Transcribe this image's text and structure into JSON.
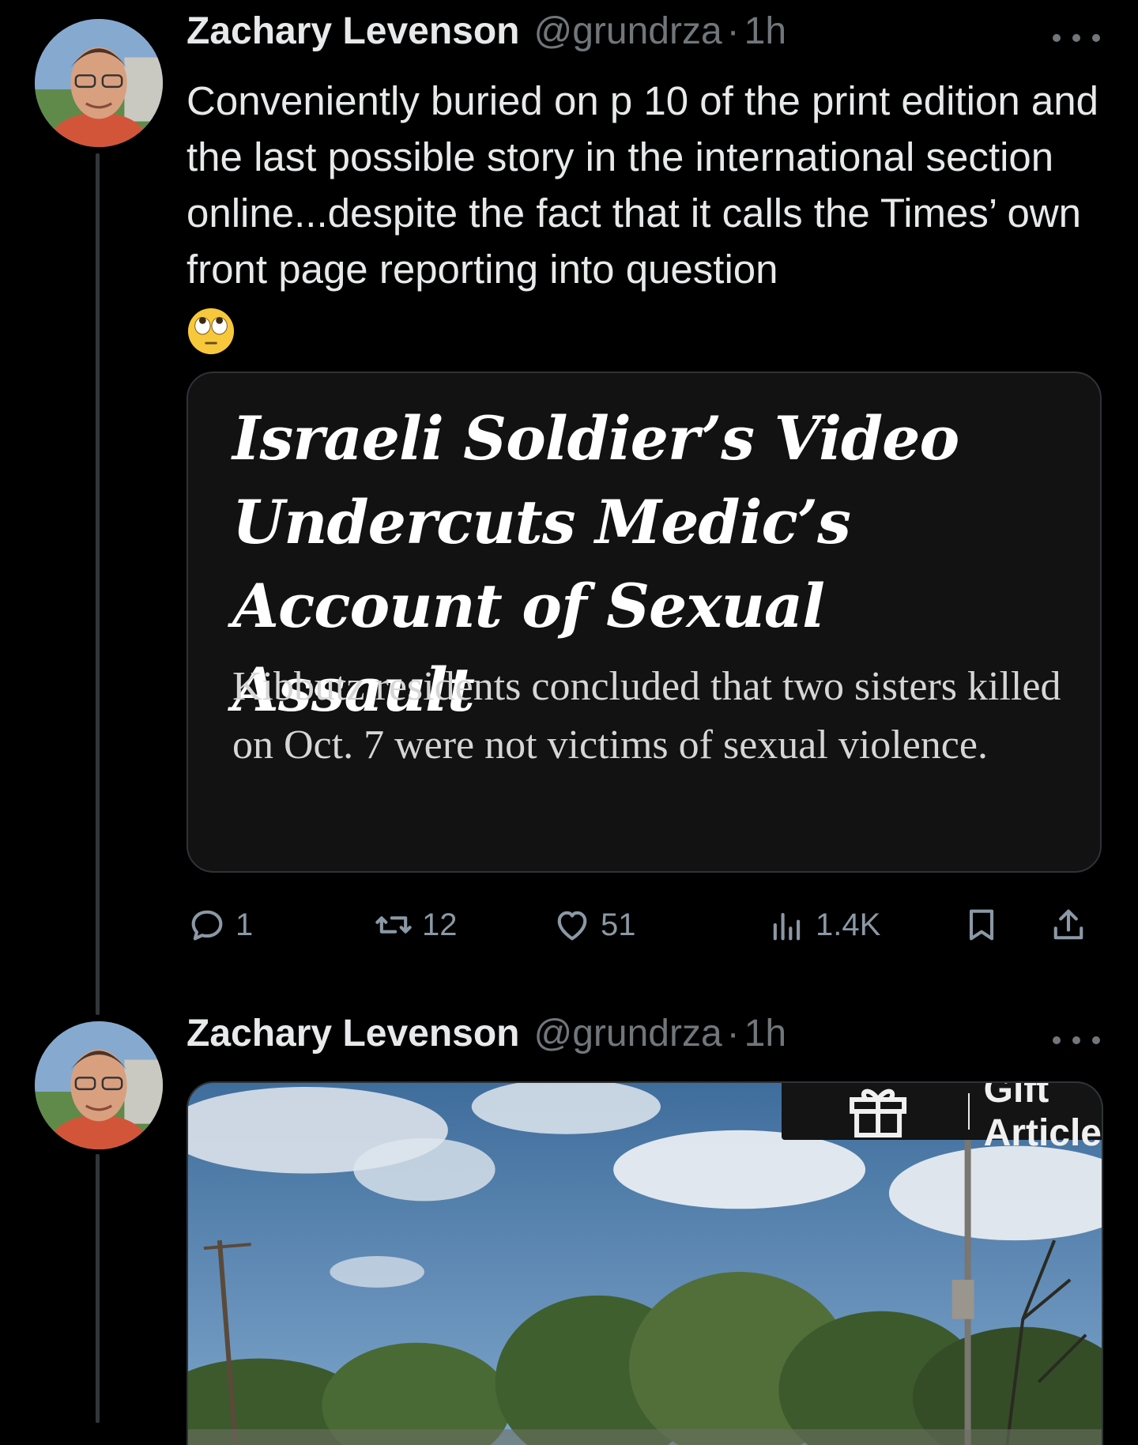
{
  "tweets": [
    {
      "author": {
        "name": "Zachary Levenson",
        "handle": "@grundrza",
        "time": "1h"
      },
      "text": "Conveniently buried on p 10 of the print edition and the last possible story in the international section online...despite the fact that it calls the Times’ own front page reporting into question",
      "emoji": "face-with-rolling-eyes",
      "card": {
        "headline": "Israeli Soldier’s Video Undercuts Medic’s Account of Sexual Assault",
        "summary": "Kibbutz residents concluded that two sisters killed on Oct. 7 were not victims of sexual violence."
      },
      "actions": {
        "replies": "1",
        "reposts": "12",
        "likes": "51",
        "views": "1.4K"
      }
    },
    {
      "author": {
        "name": "Zachary Levenson",
        "handle": "@grundrza",
        "time": "1h"
      },
      "media": {
        "gift_label": "Gift Article"
      }
    }
  ],
  "icons": {
    "reply": "reply-icon",
    "repost": "repost-icon",
    "like": "heart-icon",
    "views": "views-icon",
    "bookmark": "bookmark-icon",
    "share": "share-icon",
    "more": "more-icon",
    "gift": "gift-icon"
  },
  "colors": {
    "background": "#000000",
    "text": "#e7e9ea",
    "secondary": "#71767b",
    "card": "#121212"
  }
}
